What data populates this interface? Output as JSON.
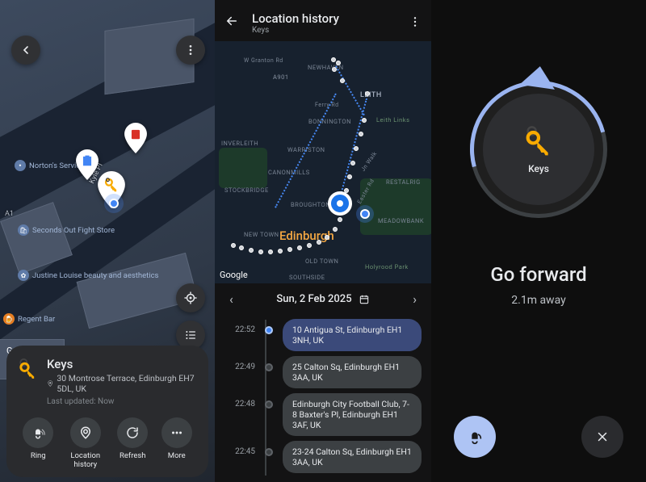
{
  "panel1": {
    "map_labels": {
      "a1": "A1",
      "street": "Kyle Pl",
      "google": "Google"
    },
    "pois": {
      "norton": "Norton's Servicing",
      "seconds": "Seconds Out Fight Store",
      "justine": "Justine Louise beauty and aesthetics",
      "regent": "Regent Bar"
    },
    "card": {
      "title": "Keys",
      "address": "30 Montrose Terrace, Edinburgh EH7 5DL, UK",
      "updated": "Last updated: Now",
      "actions": {
        "ring": "Ring",
        "history": "Location history",
        "refresh": "Refresh",
        "more": "More"
      }
    }
  },
  "panel2": {
    "title": "Location history",
    "subtitle": "Keys",
    "city": "Edinburgh",
    "google": "Google",
    "hoods": {
      "leith": "LEITH",
      "newhaven": "NEWHAVEN",
      "bonnington": "BONNINGTON",
      "warriston": "WARRISTON",
      "canonmills": "CANONMILLS",
      "stockbridge": "STOCKBRIDGE",
      "inverleith": "INVERLEITH",
      "broughton": "BROUGHTON",
      "newtown": "NEW TOWN",
      "oldtown": "OLD TOWN",
      "southside": "SOUTHSIDE",
      "restalrig": "RESTALRIG",
      "meadowbank": "MEADOWBANK",
      "leithlinks": "Leith Links",
      "holyrood": "Holyrood Park",
      "a901": "A901",
      "granton": "W Granton Rd",
      "ferry": "Ferry Rd",
      "easter": "Easter Rd",
      "jwalk": "Jn Walk"
    },
    "date": "Sun, 2 Feb 2025",
    "timeline": [
      {
        "time": "22:52",
        "text": "10 Antigua St, Edinburgh EH1 3NH, UK",
        "current": true
      },
      {
        "time": "22:49",
        "text": "25 Calton Sq, Edinburgh EH1 3AA, UK",
        "current": false
      },
      {
        "time": "22:48",
        "text": "Edinburgh City Football Club, 7-8 Baxter's Pl, Edinburgh EH1 3AF, UK",
        "current": false
      },
      {
        "time": "22:45",
        "text": "23-24 Calton Sq, Edinburgh EH1 3AA, UK",
        "current": false
      }
    ]
  },
  "panel3": {
    "item": "Keys",
    "direction": "Go forward",
    "distance": "2.1m away"
  }
}
